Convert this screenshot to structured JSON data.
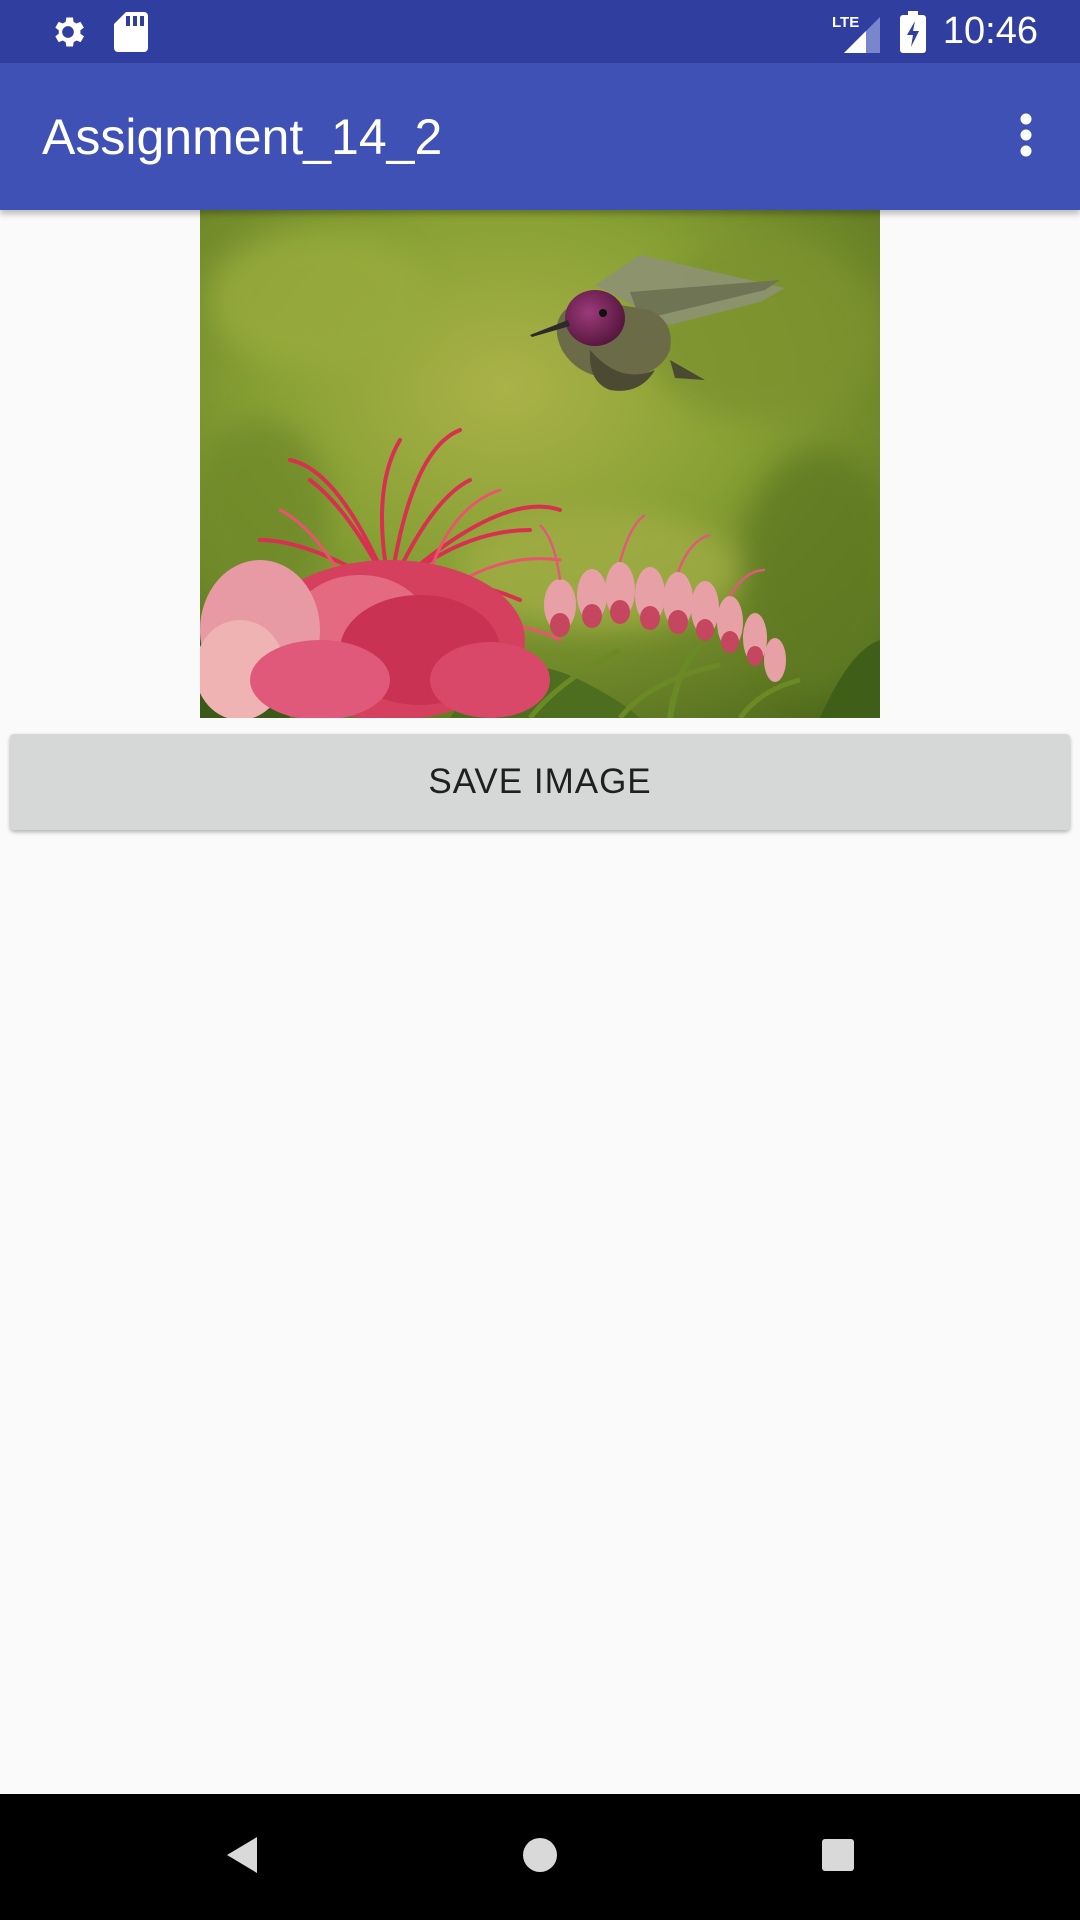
{
  "status_bar": {
    "time": "10:46",
    "network": "LTE",
    "icons": [
      "settings-icon",
      "sd-card-icon",
      "lte-signal-icon",
      "battery-charging-icon"
    ]
  },
  "app_bar": {
    "title": "Assignment_14_2",
    "overflow_icon": "more-vert-icon"
  },
  "main": {
    "image": {
      "subject": "hummingbird-over-red-flowers"
    },
    "save_button_label": "SAVE IMAGE"
  },
  "nav_bar": {
    "icons": [
      "back-icon",
      "home-icon",
      "recents-icon"
    ]
  },
  "colors": {
    "status_bar": "#303f9f",
    "app_bar": "#3f51b5",
    "background": "#fafafa",
    "button": "#d6d7d7"
  }
}
